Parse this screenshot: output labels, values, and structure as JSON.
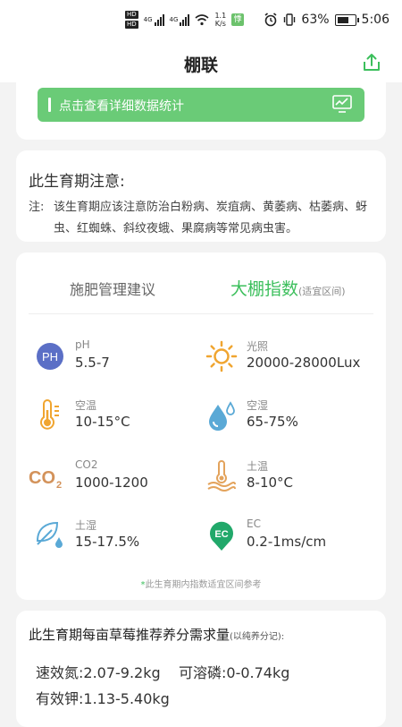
{
  "status_bar": {
    "hd1": "HD",
    "hd2": "HD",
    "net1": "4G",
    "net2": "4G",
    "speed_value": "1.1",
    "speed_unit": "K/s",
    "eco_label": "悸",
    "battery_percent": "63%",
    "time": "5:06"
  },
  "header": {
    "title": "棚联",
    "share_icon": "share-icon"
  },
  "stats_card": {
    "button_label": "点击查看详细数据统计",
    "chart_icon": "monitor-chart-icon",
    "accent_color": "#6acb77"
  },
  "stage_notice": {
    "heading": "此生育期注意:",
    "note_prefix": "注:",
    "note_text": "该生育期应该注意防治白粉病、炭疽病、黄萎病、枯萎病、蚜虫、红蜘蛛、斜纹夜蛾、果腐病等常见病虫害。"
  },
  "index_card": {
    "tab_fertilizer": "施肥管理建议",
    "tab_index": "大棚指数",
    "tab_index_suffix": "(适宜区间)",
    "active_tab_color": "#3cbf5c",
    "metrics": [
      {
        "name": "pH",
        "value": "5.5-7",
        "icon": "ph-icon"
      },
      {
        "name": "光照",
        "value": "20000-28000Lux",
        "icon": "sun-icon"
      },
      {
        "name": "空温",
        "value": "10-15°C",
        "icon": "thermometer-icon"
      },
      {
        "name": "空湿",
        "value": "65-75%",
        "icon": "humidity-drop-icon"
      },
      {
        "name": "CO2",
        "value": "1000-1200",
        "icon": "co2-icon"
      },
      {
        "name": "土温",
        "value": "8-10°C",
        "icon": "soil-temperature-icon"
      },
      {
        "name": "土湿",
        "value": "15-17.5%",
        "icon": "leaf-water-icon"
      },
      {
        "name": "EC",
        "value": "0.2-1ms/cm",
        "icon": "ec-pin-icon"
      }
    ],
    "footnote_star": "*",
    "footnote": "此生育期内指数适宜区间参考"
  },
  "nutrient_card": {
    "heading": "此生育期每亩草莓推荐养分需求量",
    "heading_suffix": "(以纯养分记):",
    "nitrogen": "速效氮:2.07-9.2kg",
    "phosphorus": "可溶磷:0-0.74kg",
    "potassium": "有效钾:1.13-5.40kg"
  }
}
